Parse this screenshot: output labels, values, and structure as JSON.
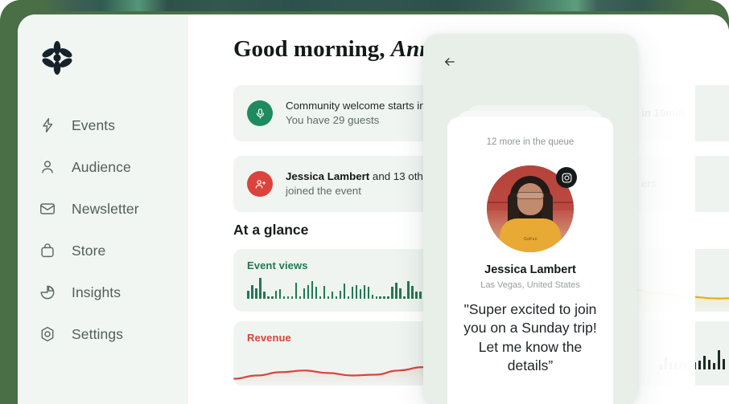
{
  "app": {
    "frame_color": "#4a6f47",
    "sidebar_bg": "#f2f6f3",
    "logo_icon": "asterisk-logo-icon"
  },
  "sidebar": {
    "items": [
      {
        "label": "Events",
        "icon": "lightning-bolt-icon"
      },
      {
        "label": "Audience",
        "icon": "person-icon"
      },
      {
        "label": "Newsletter",
        "icon": "envelope-icon"
      },
      {
        "label": "Store",
        "icon": "shopping-bag-icon"
      },
      {
        "label": "Insights",
        "icon": "pie-chart-icon"
      },
      {
        "label": "Settings",
        "icon": "hexagon-gear-icon"
      }
    ]
  },
  "header": {
    "greeting_prefix": "Good morning, ",
    "greeting_name": "Anna"
  },
  "notifications": [
    {
      "icon": "microphone-icon",
      "badge_color": "#1e8a5f",
      "title_lead": "Community welcome starts in ",
      "title_bold": "10min",
      "subtitle": "You have 29 guests"
    },
    {
      "icon": "person-add-icon",
      "badge_color": "#dd433d",
      "title_bold": "Jessica Lambert",
      "title_tail": " and 13 others",
      "subtitle": "joined the event"
    }
  ],
  "notifications_right": [
    {
      "text": "in 10min"
    },
    {
      "text": "ers"
    }
  ],
  "section": {
    "at_a_glance": "At a glance"
  },
  "chart_data": [
    {
      "type": "bar",
      "title": "Event views",
      "color": "#1e7a50",
      "values": [
        9,
        15,
        11,
        22,
        8,
        3,
        3,
        9,
        10,
        3,
        3,
        3,
        17,
        3,
        11,
        15,
        19,
        13,
        3,
        14,
        3,
        8,
        3,
        9,
        16,
        3,
        13,
        15,
        10,
        15,
        13,
        4,
        3,
        3,
        3,
        3,
        13,
        17,
        11,
        3,
        19,
        14,
        8,
        8,
        11,
        17,
        8,
        16,
        9,
        12,
        8,
        6,
        6,
        8,
        7
      ],
      "ylim": [
        0,
        24
      ],
      "grid": false
    },
    {
      "type": "area",
      "title": "Revenue",
      "color": "#d9443c",
      "x": [
        0,
        1,
        2,
        3,
        4,
        5,
        6,
        7,
        8,
        9,
        10,
        11,
        12,
        13,
        14,
        15,
        16
      ],
      "values": [
        8,
        12,
        16,
        18,
        15,
        12,
        13,
        18,
        22,
        23,
        24,
        30,
        38,
        44,
        42,
        38,
        40
      ],
      "ylim": [
        0,
        50
      ],
      "grid": false
    },
    {
      "type": "area",
      "title": "",
      "color": "#e8ad16",
      "x": [
        0,
        1,
        2,
        3,
        4,
        5,
        6,
        7,
        8
      ],
      "values": [
        26,
        21,
        17,
        15,
        16,
        20,
        26,
        32,
        36
      ],
      "ylim": [
        0,
        44
      ],
      "grid": false
    },
    {
      "type": "bar",
      "title": "",
      "color": "#1d2a26",
      "values": [
        6,
        16,
        9,
        10,
        10,
        9,
        10,
        10,
        12,
        18,
        13,
        9,
        26,
        14
      ],
      "ylim": [
        0,
        28
      ],
      "grid": false
    }
  ],
  "phone": {
    "back_icon": "arrow-left-icon",
    "queue_count_text": "12 more in the queue",
    "social_badge_icon": "instagram-icon",
    "profile": {
      "name": "Jessica Lambert",
      "location": "Las Vegas, United States",
      "quote": "\"Super excited to join you on a Sunday trip! Let me know the details”"
    }
  }
}
